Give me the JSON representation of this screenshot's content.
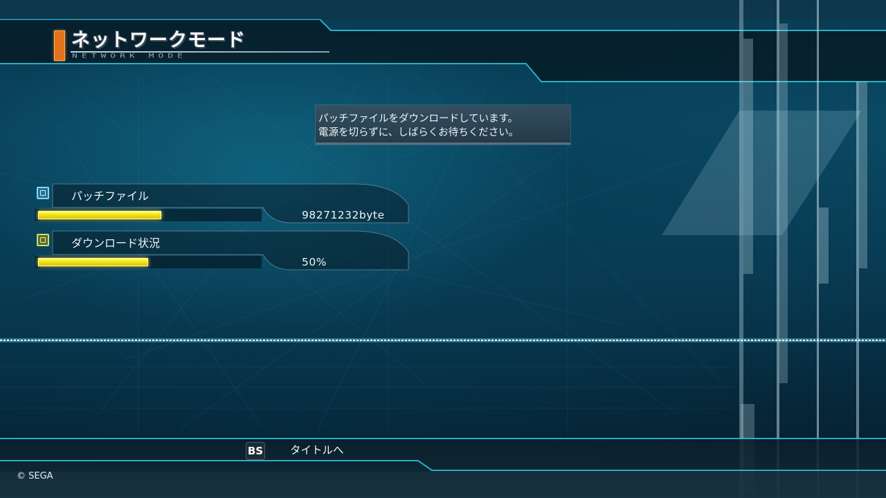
{
  "header": {
    "title": "ネットワークモード",
    "subtitle": "NETWORK MODE"
  },
  "message": {
    "line1": "パッチファイルをダウンロードしています。",
    "line2": "電源を切らずに、しばらくお待ちください。"
  },
  "patch_file": {
    "label": "パッチファイル",
    "size": "98271232byte",
    "bar_fill_fraction": 0.56
  },
  "download_status": {
    "label": "ダウンロード状況",
    "percent_text": "50%",
    "progress_fraction": 0.5
  },
  "footer": {
    "button_key": "BS",
    "button_label": "タイトルへ",
    "copyright": "© SEGA"
  },
  "colors": {
    "accent_orange": "#e2731a",
    "bar_yellow": "#f3e51e",
    "frame_cyan": "#2ec6e0",
    "background": "#0a3b52"
  },
  "icons": {
    "patch_file": "square-icon-blue",
    "download_status": "square-icon-green"
  }
}
